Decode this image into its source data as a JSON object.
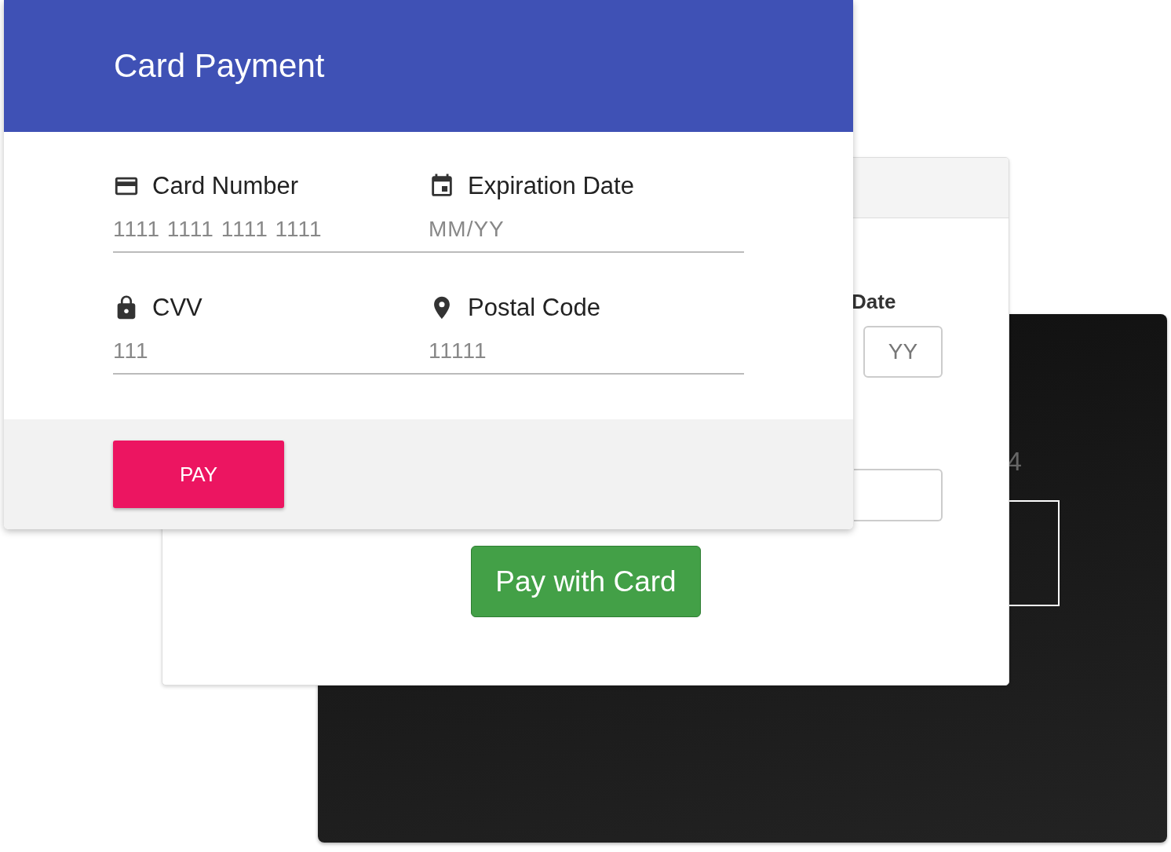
{
  "front_card": {
    "title": "Card Payment",
    "fields": [
      {
        "label": "Card Number",
        "placeholder": "1111 1111 1111 1111"
      },
      {
        "label": "Expiration Date",
        "placeholder": "MM/YY"
      },
      {
        "label": "CVV",
        "placeholder": "111"
      },
      {
        "label": "Postal Code",
        "placeholder": "11111"
      }
    ],
    "pay_button": "PAY"
  },
  "middle_card": {
    "label": "Date",
    "year_field": {
      "placeholder": "YY"
    },
    "pay_button": "Pay with Card"
  },
  "back_card": {
    "digit_text": "4"
  }
}
